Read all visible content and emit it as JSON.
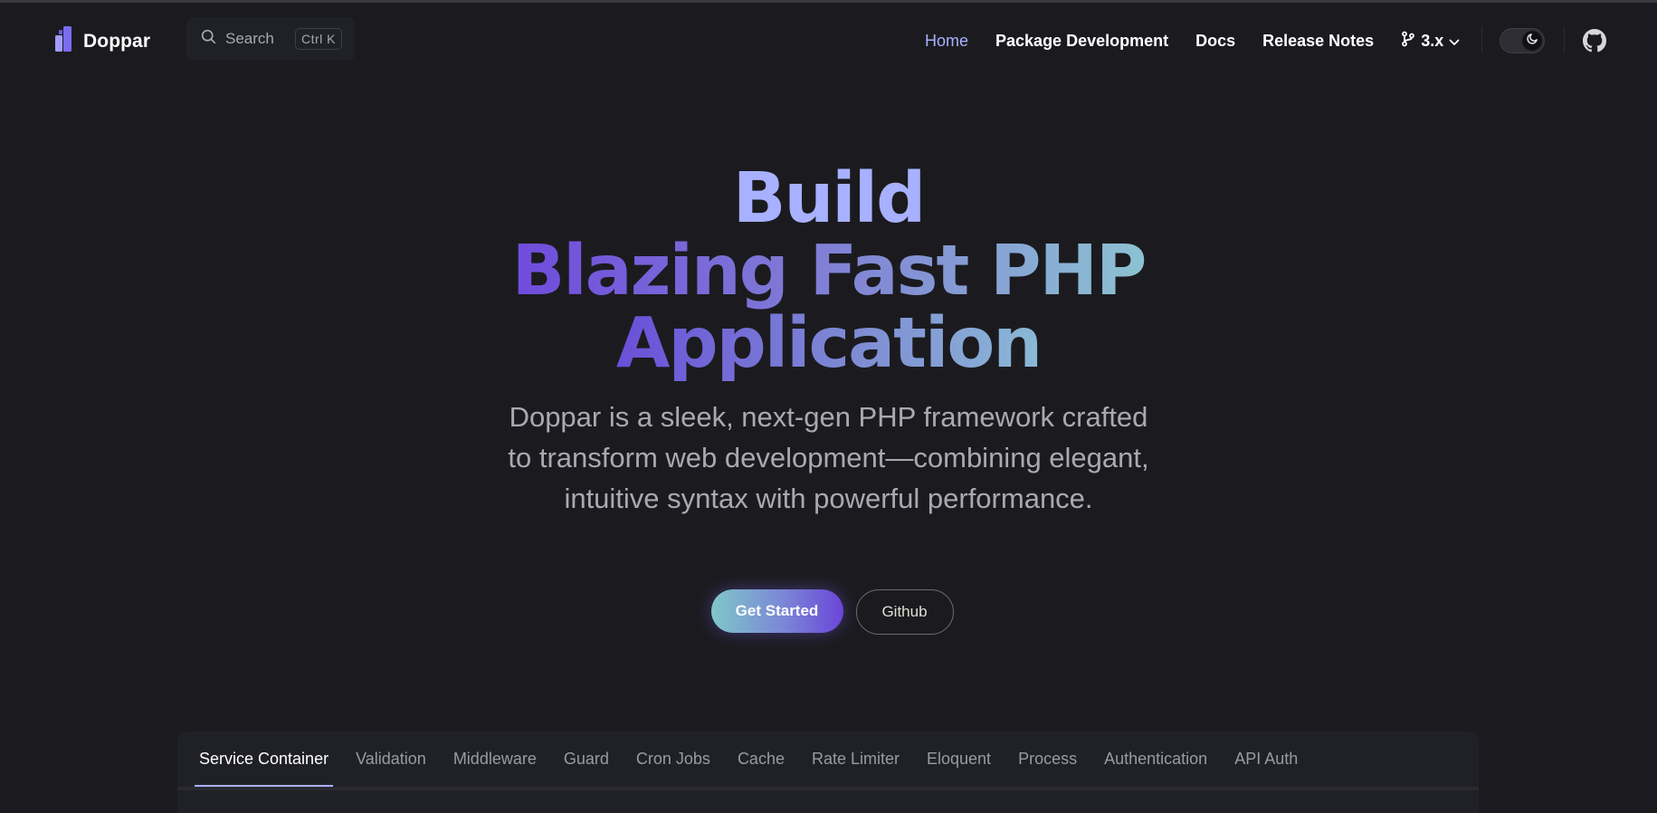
{
  "nav": {
    "brand": "Doppar",
    "search_label": "Search",
    "search_shortcut": "Ctrl K",
    "links": [
      "Home",
      "Package Development",
      "Docs",
      "Release Notes"
    ],
    "active_link": "Home",
    "version": "3.x",
    "icons": {
      "logo": "doppar-logo-icon",
      "search": "search-icon",
      "branch": "git-branch-icon",
      "chevron": "chevron-down-icon",
      "theme": "moon-icon",
      "github": "github-icon"
    }
  },
  "hero": {
    "line1": "Build",
    "line2": "Blazing Fast PHP",
    "line3": "Application",
    "tagline": "Doppar is a sleek, next-gen PHP framework crafted to transform web development—combining elegant, intuitive syntax with powerful performance.",
    "primary_button": "Get Started",
    "secondary_button": "Github"
  },
  "tabs": {
    "items": [
      "Service Container",
      "Validation",
      "Middleware",
      "Guard",
      "Cron Jobs",
      "Cache",
      "Rate Limiter",
      "Eloquent",
      "Process",
      "Authentication",
      "API Auth"
    ],
    "active": "Service Container"
  },
  "colors": {
    "background": "#1b1b1f",
    "accent": "#a8b1ff",
    "gradient_start": "#6f4bdc",
    "gradient_end": "#8cc2d2"
  }
}
